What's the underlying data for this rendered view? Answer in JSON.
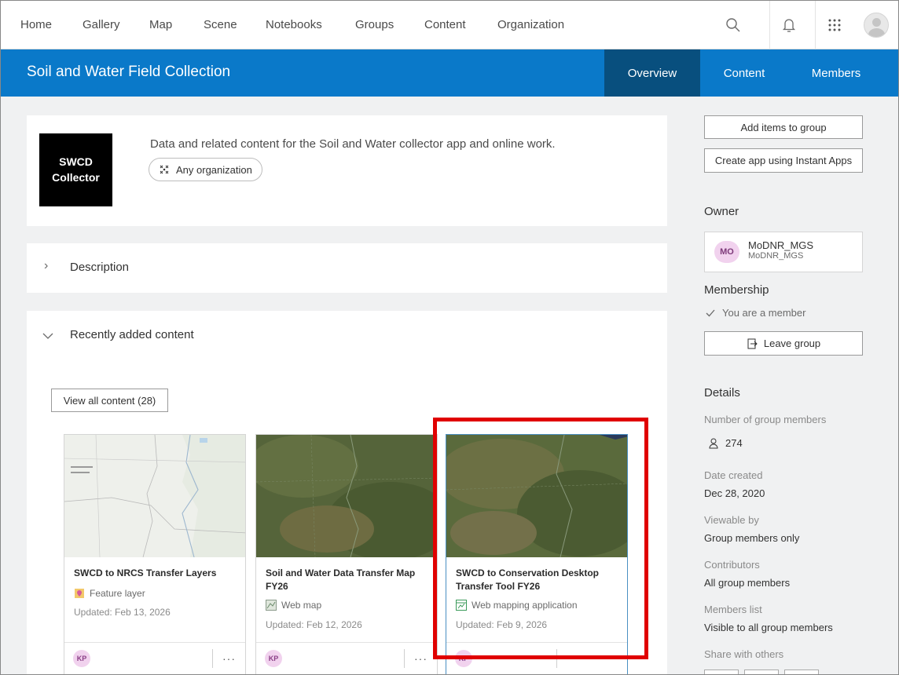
{
  "nav": {
    "items": [
      "Home",
      "Gallery",
      "Map",
      "Scene",
      "Notebooks",
      "Groups",
      "Content",
      "Organization"
    ]
  },
  "group": {
    "title": "Soil and Water Field Collection",
    "tabs": [
      "Overview",
      "Content",
      "Members"
    ],
    "active_tab": "Overview",
    "logo_line1": "SWCD",
    "logo_line2": "Collector",
    "summary": "Data and related content for the Soil and Water collector app and online work.",
    "access_chip": "Any organization"
  },
  "sections": {
    "description_label": "Description",
    "recent_label": "Recently added content",
    "view_all_label": "View all content (28)"
  },
  "items": [
    {
      "title": "SWCD to NRCS Transfer Layers",
      "type": "Feature layer",
      "type_icon": "feature-layer-icon",
      "updated": "Updated: Feb 13, 2026",
      "owner_initials": "KP",
      "thumb": "basemap-light"
    },
    {
      "title": "Soil and Water Data Transfer Map FY26",
      "type": "Web map",
      "type_icon": "web-map-icon",
      "updated": "Updated: Feb 12, 2026",
      "owner_initials": "KP",
      "thumb": "satellite"
    },
    {
      "title": "SWCD to Conservation Desktop Transfer Tool FY26",
      "type": "Web mapping application",
      "type_icon": "web-app-icon",
      "updated": "Updated: Feb 9, 2026",
      "owner_initials": "KP",
      "thumb": "satellite"
    }
  ],
  "sidebar": {
    "add_items": "Add items to group",
    "create_app": "Create app using Instant Apps",
    "owner_heading": "Owner",
    "owner_initials": "MO",
    "owner_name": "MoDNR_MGS",
    "owner_username": "MoDNR_MGS",
    "membership_heading": "Membership",
    "membership_status": "You are a member",
    "leave_group": "Leave group",
    "details_heading": "Details",
    "members_count_label": "Number of group members",
    "members_count": "274",
    "date_created_label": "Date created",
    "date_created": "Dec 28, 2020",
    "viewable_label": "Viewable by",
    "viewable": "Group members only",
    "contributors_label": "Contributors",
    "contributors": "All group members",
    "members_list_label": "Members list",
    "members_list": "Visible to all group members",
    "share_label": "Share with others"
  },
  "colors": {
    "brand": "#0a79c9",
    "active_tab": "#084f7e",
    "highlight": "#e00000"
  }
}
